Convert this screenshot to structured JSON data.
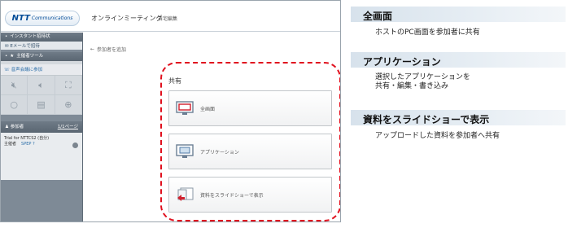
{
  "window": {
    "logo_text": "NTT",
    "logo_sub": "Communications",
    "app_title": "オンラインミーティング",
    "user_name": "自宅編集"
  },
  "sidebar": {
    "instant_header": "インスタント招待状",
    "email_invite": "Eメールで招待",
    "host_tools_header": "主催者ツール",
    "audio_join": "音声会議に参加",
    "participants_header": "参加者",
    "participants_link": "1/1ページ",
    "participant": {
      "name": "Trial for NTTCS2 (自分)",
      "role": "主催者",
      "tag": "SPEP ?"
    }
  },
  "content": {
    "breadcrumb": "参加者を追加",
    "share_label": "共有",
    "options": [
      {
        "label": "全画面",
        "icon": "monitor-red-icon"
      },
      {
        "label": "アプリケーション",
        "icon": "application-window-icon"
      },
      {
        "label": "資料をスライドショーで表示",
        "icon": "slideshow-icon"
      }
    ],
    "highlight_color": "#e0101e"
  },
  "descriptions": [
    {
      "title": "全画面",
      "lines": [
        "ホストのPC画面を参加者に共有"
      ]
    },
    {
      "title": "アプリケーション",
      "lines": [
        "選択したアプリケーションを",
        "共有・編集・書き込み"
      ]
    },
    {
      "title": "資料をスライドショーで表示",
      "lines": [
        "アップロードした資料を参加者へ共有"
      ]
    }
  ]
}
